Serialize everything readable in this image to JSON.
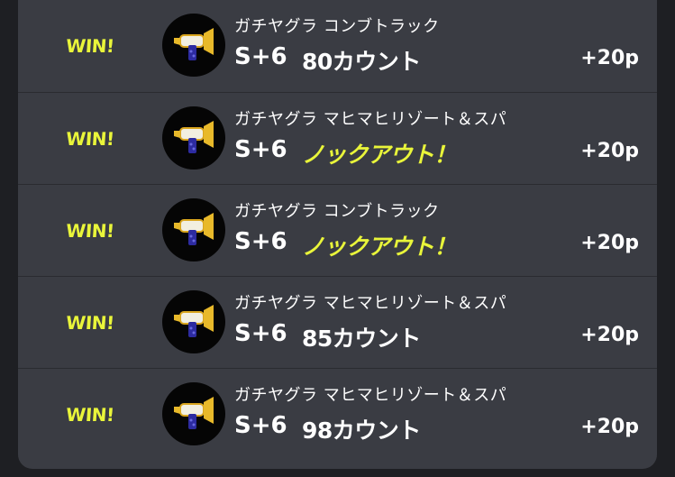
{
  "battles": [
    {
      "result_label": "WIN!",
      "weapon_icon": "splattershot-jr-icon",
      "mode_stage": "ガチヤグラ コンブトラック",
      "rank": "S+6",
      "score": "80カウント",
      "knockout": false,
      "points": "+20p"
    },
    {
      "result_label": "WIN!",
      "weapon_icon": "splattershot-jr-icon",
      "mode_stage": "ガチヤグラ マヒマヒリゾート＆スパ",
      "rank": "S+6",
      "score": "ノックアウト！",
      "knockout": true,
      "points": "+20p"
    },
    {
      "result_label": "WIN!",
      "weapon_icon": "splattershot-jr-icon",
      "mode_stage": "ガチヤグラ コンブトラック",
      "rank": "S+6",
      "score": "ノックアウト！",
      "knockout": true,
      "points": "+20p"
    },
    {
      "result_label": "WIN!",
      "weapon_icon": "splattershot-jr-icon",
      "mode_stage": "ガチヤグラ マヒマヒリゾート＆スパ",
      "rank": "S+6",
      "score": "85カウント",
      "knockout": false,
      "points": "+20p"
    },
    {
      "result_label": "WIN!",
      "weapon_icon": "splattershot-jr-icon",
      "mode_stage": "ガチヤグラ マヒマヒリゾート＆スパ",
      "rank": "S+6",
      "score": "98カウント",
      "knockout": false,
      "points": "+20p"
    }
  ],
  "colors": {
    "background": "#1e1f23",
    "panel": "#3a3c43",
    "divider": "#2a2b30",
    "win": "#e9f53a",
    "knockout": "#e9f53a",
    "text": "#ffffff"
  }
}
